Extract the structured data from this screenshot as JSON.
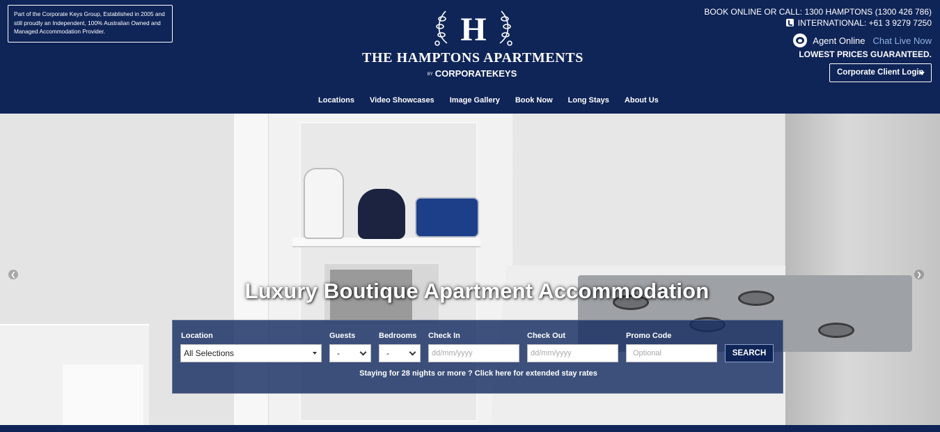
{
  "header": {
    "about_text": "Part of the Corporate Keys Group, Established in 2005 and still proudly an Independent, 100% Australian Owned and Managed Accommodation Provider.",
    "logo_letter": "H",
    "logo_name": "THE HAMPTONS APARTMENTS",
    "logo_by": "BY",
    "logo_brand": "CORPORATEKEYS",
    "book_line": "BOOK ONLINE OR CALL: 1300 HAMPTONS (1300 426 786)",
    "international_line": "INTERNATIONAL: +61 3 9279 7250",
    "agent_status": "Agent Online",
    "chat_link": "Chat Live Now",
    "lowest_prices": "LOWEST PRICES GUARANTEED.",
    "client_login": "Corporate Client Login"
  },
  "nav": {
    "items": [
      {
        "label": "Locations"
      },
      {
        "label": "Video Showcases"
      },
      {
        "label": "Image Gallery"
      },
      {
        "label": "Book Now"
      },
      {
        "label": "Long Stays"
      },
      {
        "label": "About Us"
      }
    ]
  },
  "hero": {
    "headline": "Luxury Boutique Apartment Accommodation",
    "arrow_left": "❮",
    "arrow_right": "❯"
  },
  "search": {
    "location_label": "Location",
    "location_value": "All Selections",
    "guests_label": "Guests",
    "guests_value": "-",
    "bedrooms_label": "Bedrooms",
    "bedrooms_value": "-",
    "checkin_label": "Check In",
    "checkin_placeholder": "dd/mm/yyyy",
    "checkout_label": "Check Out",
    "checkout_placeholder": "dd/mm/yyyy",
    "promo_label": "Promo Code",
    "promo_placeholder": "Optional",
    "search_button": "SEARCH",
    "extended_text": "Staying for 28 nights or more ? Click here for extended stay rates"
  },
  "colors": {
    "navy": "#0f2457",
    "chat_link": "#8fb4e6"
  }
}
